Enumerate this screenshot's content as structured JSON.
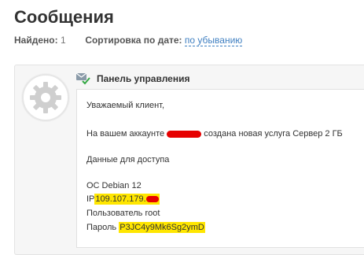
{
  "page_title": "Сообщения",
  "filters": {
    "found_label": "Найдено:",
    "found_count": "1",
    "sort_label": "Сортировка по дате:",
    "sort_value": "по убыванию"
  },
  "message": {
    "sender": "Панель управления",
    "greeting": "Уважаемый клиент,",
    "service_prefix": "На вашем аккаунте",
    "service_suffix": "создана новая услуга Сервер 2 ГБ",
    "access_heading": "Данные для доступа",
    "os_line": "ОС Debian 12",
    "ip_label": "IP",
    "ip_value": "109.107.179.",
    "user_line": "Пользователь root",
    "password_label": "Пароль",
    "password_value": "P3JC4y9Mk6Sg2ymD"
  },
  "colors": {
    "link": "#3f7fc1",
    "highlight": "#ffe600",
    "redaction": "#e60000",
    "check": "#35a845"
  },
  "icons": {
    "avatar": "gear-icon",
    "sender": "envelope-check-icon"
  }
}
